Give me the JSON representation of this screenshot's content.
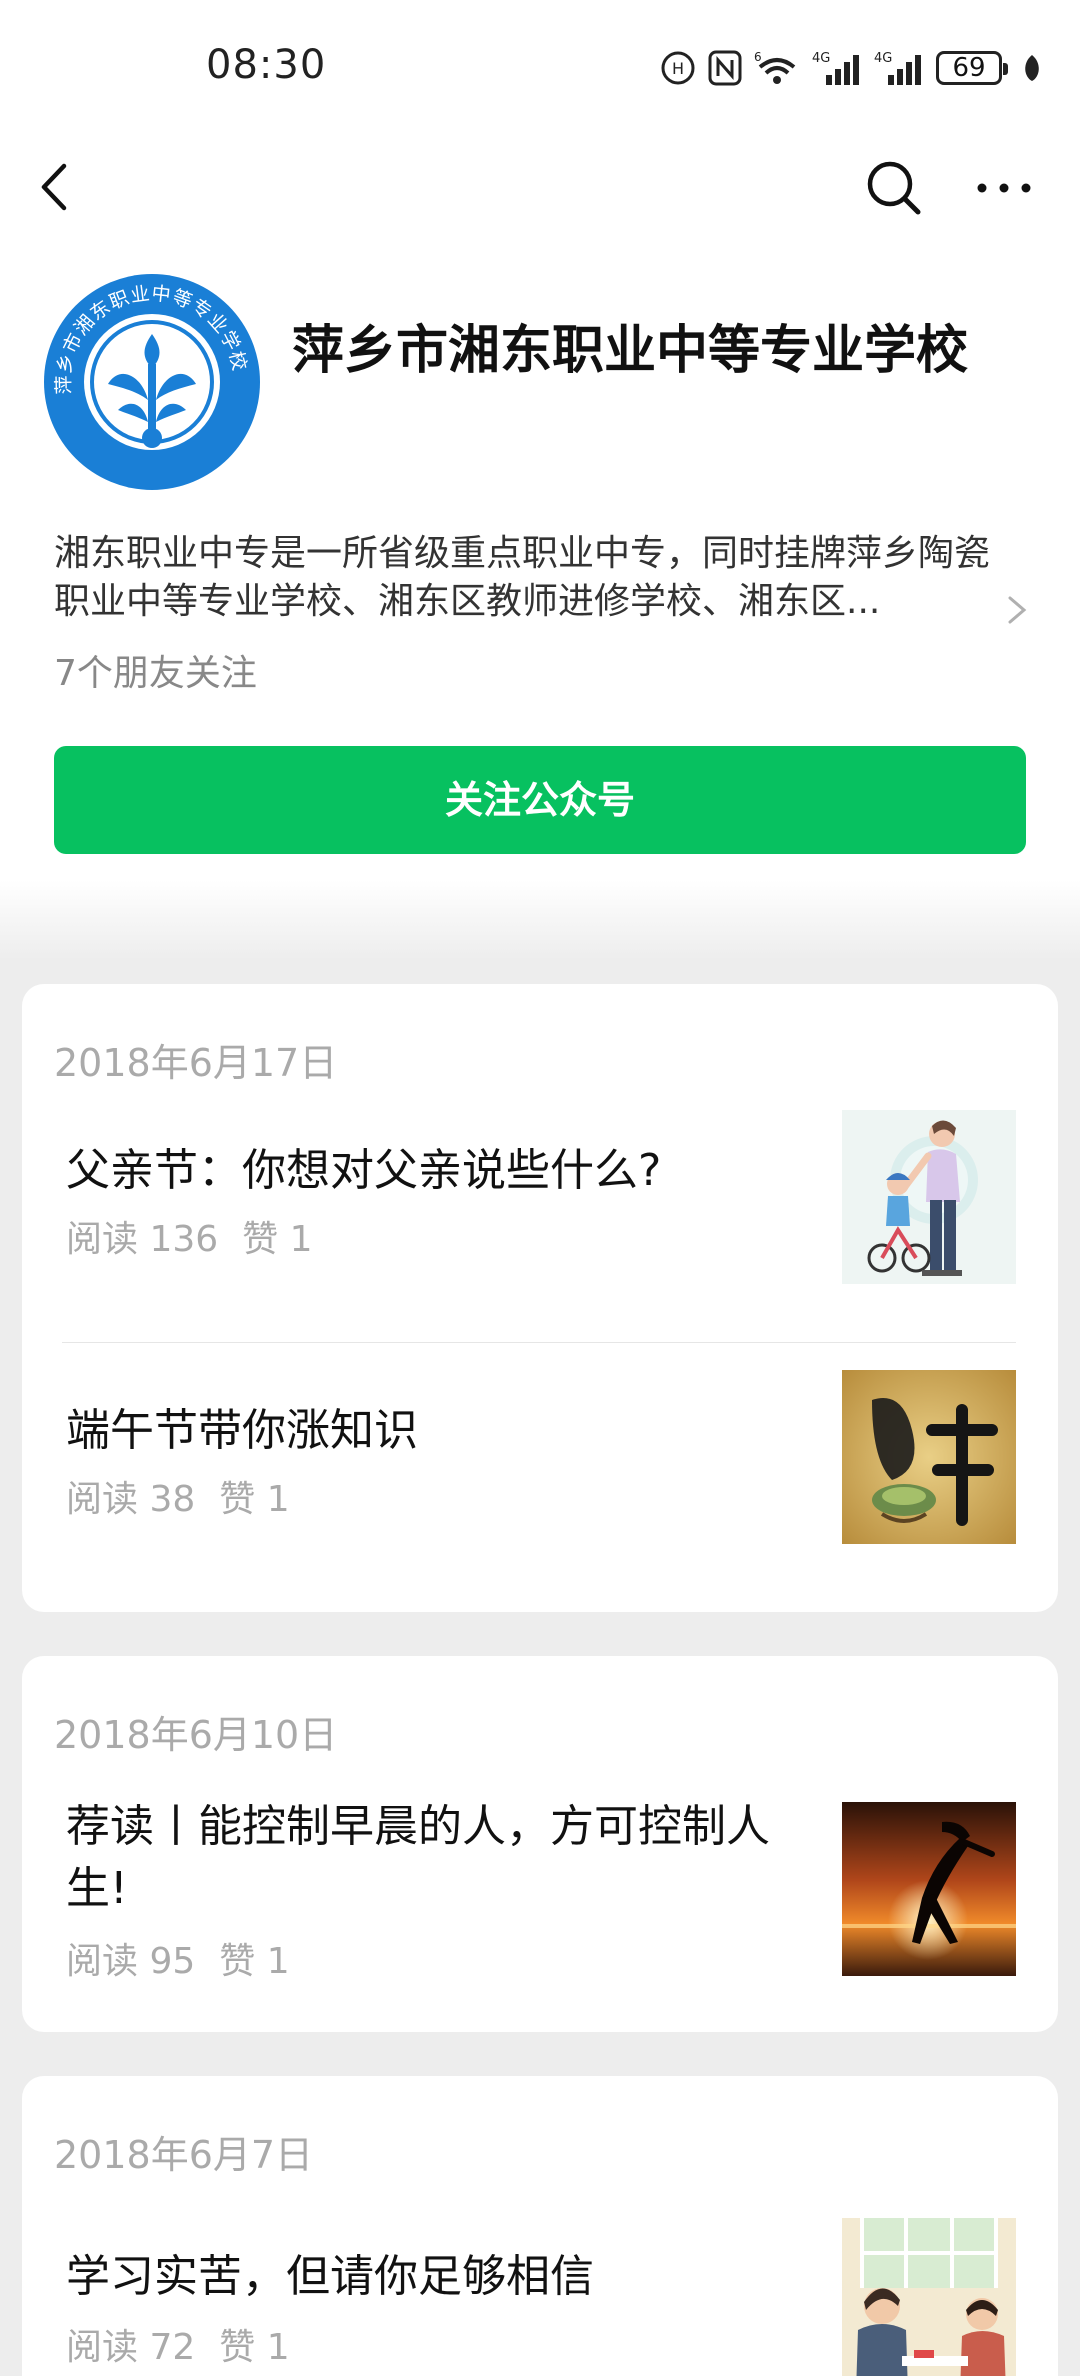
{
  "status_bar": {
    "time": "08:30",
    "network_1": "6",
    "network_2": "4G",
    "network_3": "4G",
    "battery": "69"
  },
  "nav": {
    "back_icon": "chevron-left-icon",
    "search_icon": "search-icon",
    "more_icon": "more-horizontal-icon"
  },
  "profile": {
    "name": "萍乡市湘东职业中等专业学校",
    "logo_text": "萍乡市湘东职业中等专业学校",
    "description": "湘东职业中专是一所省级重点职业中专，同时挂牌萍乡陶瓷职业中等专业学校、湘东区教师进修学校、湘东区...",
    "friends_following": "7个朋友关注",
    "follow_button": "关注公众号"
  },
  "colors": {
    "accent_green": "#07c160",
    "logo_blue": "#1a7fd6",
    "background": "#ededed"
  },
  "groups": [
    {
      "date": "2018年6月17日",
      "articles": [
        {
          "title": "父亲节：你想对父亲说些什么?",
          "reads": "阅读 136",
          "likes": "赞 1",
          "thumb": "father-and-child-bicycle-illustration"
        },
        {
          "title": "端午节带你涨知识",
          "reads": "阅读 38",
          "likes": "赞 1",
          "thumb": "dragon-boat-festival-calligraphy"
        }
      ]
    },
    {
      "date": "2018年6月10日",
      "articles": [
        {
          "title": "荐读丨能控制早晨的人，方可控制人生!",
          "reads": "阅读 95",
          "likes": "赞 1",
          "thumb": "silhouette-at-sunrise"
        }
      ]
    },
    {
      "date": "2018年6月7日",
      "articles": [
        {
          "title": "学习实苦，但请你足够相信",
          "reads": "阅读 72",
          "likes": "赞 1",
          "thumb": "students-studying-illustration"
        }
      ]
    }
  ]
}
